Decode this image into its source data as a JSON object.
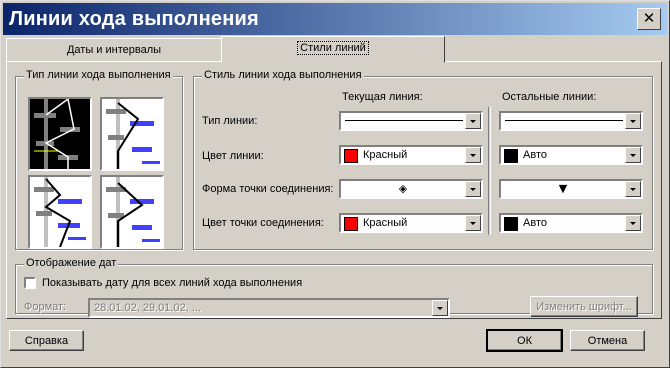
{
  "window": {
    "title": "Линии хода выполнения",
    "close_glyph": "✕"
  },
  "tabs": [
    {
      "label": "Даты и интервалы"
    },
    {
      "label": "Стили линий"
    }
  ],
  "type_group": {
    "legend": "Тип линии хода выполнения",
    "selected_index": 0
  },
  "style_group": {
    "legend": "Стиль линии хода выполнения",
    "col_current": "Текущая линия:",
    "col_other": "Остальные линии:",
    "rows": {
      "line_type": "Тип линии:",
      "line_color": "Цвет линии:",
      "point_shape": "Форма точки соединения:",
      "point_color": "Цвет точки соединения:"
    },
    "current": {
      "line_color": "Красный",
      "line_color_hex": "#ff0000",
      "point_shape_glyph": "◈",
      "point_color": "Красный",
      "point_color_hex": "#ff0000"
    },
    "other": {
      "line_color": "Авто",
      "line_color_hex": "#000000",
      "point_shape_glyph": "▼",
      "point_color": "Авто",
      "point_color_hex": "#000000"
    }
  },
  "dates_group": {
    "legend": "Отображение дат",
    "show_dates_label": "Показывать дату для всех линий хода выполнения",
    "show_dates_checked": false,
    "format_label": "Формат:",
    "format_value": "28.01.02, 29.01.02, ...",
    "font_button": "Изменить шрифт..."
  },
  "buttons": {
    "help": "Справка",
    "ok": "ОК",
    "cancel": "Отмена"
  }
}
